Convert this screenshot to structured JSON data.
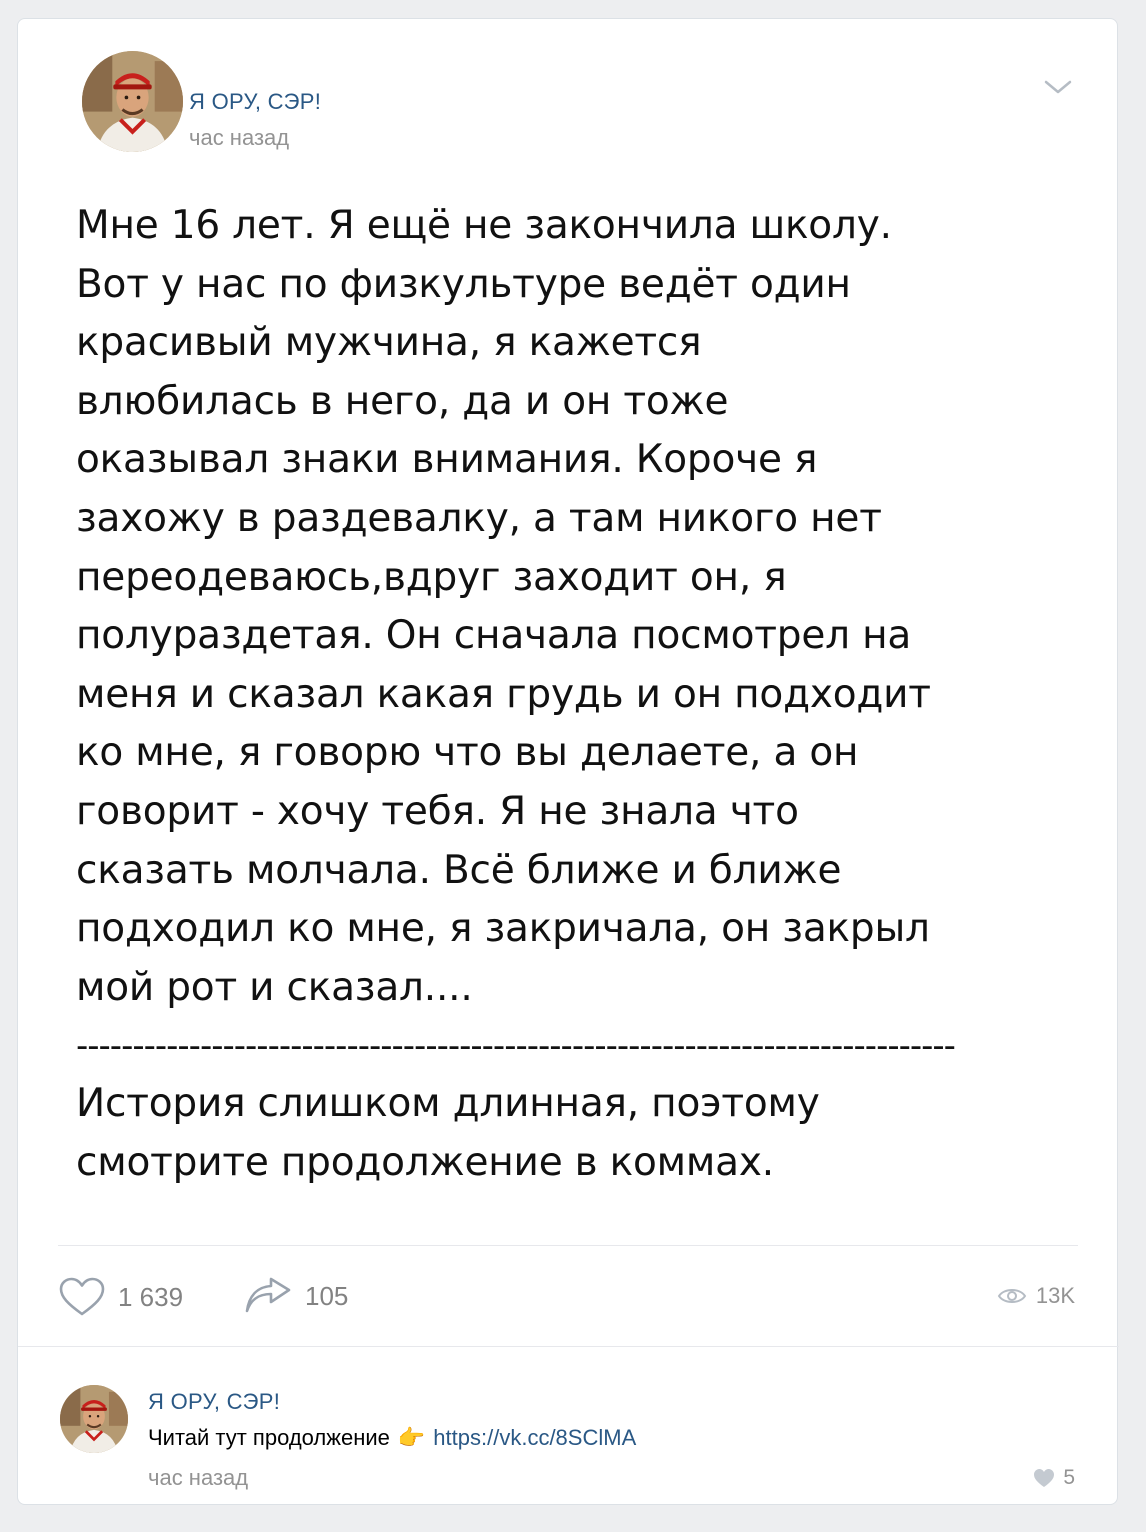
{
  "post": {
    "author": "Я ОРУ, СЭР!",
    "time": "час назад",
    "text_lines": [
      "Мне 16 лет. Я ещё не закончила школу.",
      "Вот у нас по физкультуре ведёт один",
      "красивый мужчина, я кажется",
      "влюбилась в него, да и он тоже",
      "оказывал знаки внимания. Короче я",
      "захожу в раздевалку, а там никого нет",
      "переодеваюсь,вдруг заходит он, я",
      "полураздетая. Он сначала посмотрел на",
      "меня и сказал какая грудь и он подходит",
      "ко мне, я говорю что вы делаете, а он",
      "говорит - хочу тебя. Я не знала что",
      "сказать молчала. Всё ближе и ближе",
      "подходил ко мне, я закричала, он закрыл",
      "мой рот и сказал...."
    ],
    "divider": "------------------------------------------------------------------------------",
    "footer_lines": [
      "История слишком длинная, поэтому",
      "смотрите продолжение в коммах."
    ],
    "likes": "1 639",
    "shares": "105",
    "views": "13K"
  },
  "comment": {
    "author": "Я ОРУ, СЭР!",
    "text": "Читай тут продолжение",
    "emoji": "👉",
    "link": "https://vk.cc/8SClMA",
    "time": "час назад",
    "likes": "5"
  },
  "colors": {
    "link": "#2a5885",
    "meta": "#939393",
    "background": "#edeef0"
  }
}
